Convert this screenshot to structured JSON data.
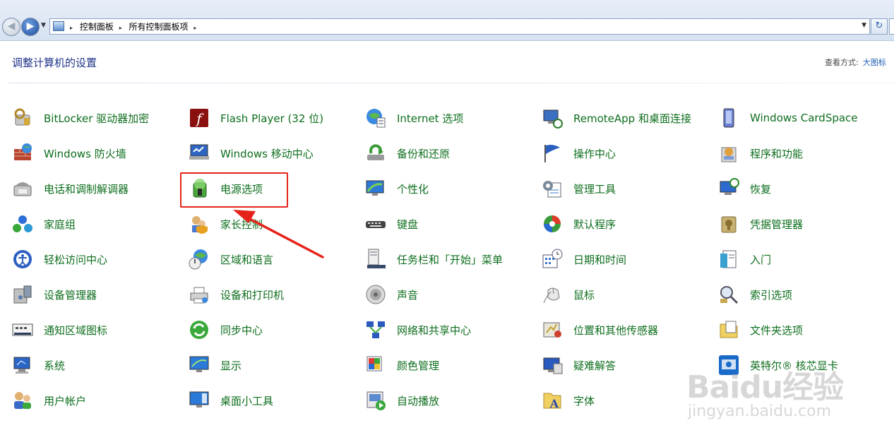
{
  "address_bar": {
    "crumbs": [
      "控制面板",
      "所有控制面板项"
    ],
    "separator": "▸"
  },
  "header": {
    "title": "调整计算机的设置",
    "view_by_label": "查看方式:",
    "view_by_value": "大图标"
  },
  "colors": {
    "link_green": "#0e6e1e",
    "title_blue": "#1e3287",
    "annotation_red": "#e5231b"
  },
  "items": [
    {
      "label": "BitLocker 驱动器加密",
      "icon": "bitlocker-icon"
    },
    {
      "label": "Flash Player (32 位)",
      "icon": "flash-player-icon"
    },
    {
      "label": "Internet 选项",
      "icon": "internet-options-icon"
    },
    {
      "label": "RemoteApp 和桌面连接",
      "icon": "remoteapp-icon"
    },
    {
      "label": "Windows CardSpace",
      "icon": "cardspace-icon"
    },
    {
      "label": "Windows 防火墙",
      "icon": "firewall-icon"
    },
    {
      "label": "Windows 移动中心",
      "icon": "mobility-center-icon"
    },
    {
      "label": "备份和还原",
      "icon": "backup-icon"
    },
    {
      "label": "操作中心",
      "icon": "action-center-flag-icon"
    },
    {
      "label": "程序和功能",
      "icon": "programs-icon"
    },
    {
      "label": "电话和调制解调器",
      "icon": "phone-modem-icon"
    },
    {
      "label": "电源选项",
      "icon": "power-options-icon"
    },
    {
      "label": "个性化",
      "icon": "personalization-icon"
    },
    {
      "label": "管理工具",
      "icon": "admin-tools-icon"
    },
    {
      "label": "恢复",
      "icon": "recovery-icon"
    },
    {
      "label": "家庭组",
      "icon": "homegroup-icon"
    },
    {
      "label": "家长控制",
      "icon": "parental-controls-icon"
    },
    {
      "label": "键盘",
      "icon": "keyboard-icon"
    },
    {
      "label": "默认程序",
      "icon": "default-programs-icon"
    },
    {
      "label": "凭据管理器",
      "icon": "credential-manager-icon"
    },
    {
      "label": "轻松访问中心",
      "icon": "ease-of-access-icon"
    },
    {
      "label": "区域和语言",
      "icon": "region-language-icon"
    },
    {
      "label": "任务栏和「开始」菜单",
      "icon": "taskbar-icon"
    },
    {
      "label": "日期和时间",
      "icon": "date-time-icon"
    },
    {
      "label": "入门",
      "icon": "getting-started-icon"
    },
    {
      "label": "设备管理器",
      "icon": "device-manager-icon"
    },
    {
      "label": "设备和打印机",
      "icon": "printer-icon"
    },
    {
      "label": "声音",
      "icon": "sound-icon"
    },
    {
      "label": "鼠标",
      "icon": "mouse-icon"
    },
    {
      "label": "索引选项",
      "icon": "indexing-icon"
    },
    {
      "label": "通知区域图标",
      "icon": "notification-area-icon"
    },
    {
      "label": "同步中心",
      "icon": "sync-center-icon"
    },
    {
      "label": "网络和共享中心",
      "icon": "network-icon"
    },
    {
      "label": "位置和其他传感器",
      "icon": "location-sensor-icon"
    },
    {
      "label": "文件夹选项",
      "icon": "folder-options-icon"
    },
    {
      "label": "系统",
      "icon": "system-icon"
    },
    {
      "label": "显示",
      "icon": "display-icon"
    },
    {
      "label": "颜色管理",
      "icon": "color-management-icon"
    },
    {
      "label": "疑难解答",
      "icon": "troubleshooting-icon"
    },
    {
      "label": "英特尔® 核芯显卡",
      "icon": "intel-graphics-icon"
    },
    {
      "label": "用户帐户",
      "icon": "user-accounts-icon"
    },
    {
      "label": "桌面小工具",
      "icon": "gadgets-icon"
    },
    {
      "label": "自动播放",
      "icon": "autoplay-icon"
    },
    {
      "label": "字体",
      "icon": "fonts-icon"
    }
  ],
  "watermark": {
    "brand": "Baidu经验",
    "url": "jingyan.baidu.com"
  }
}
